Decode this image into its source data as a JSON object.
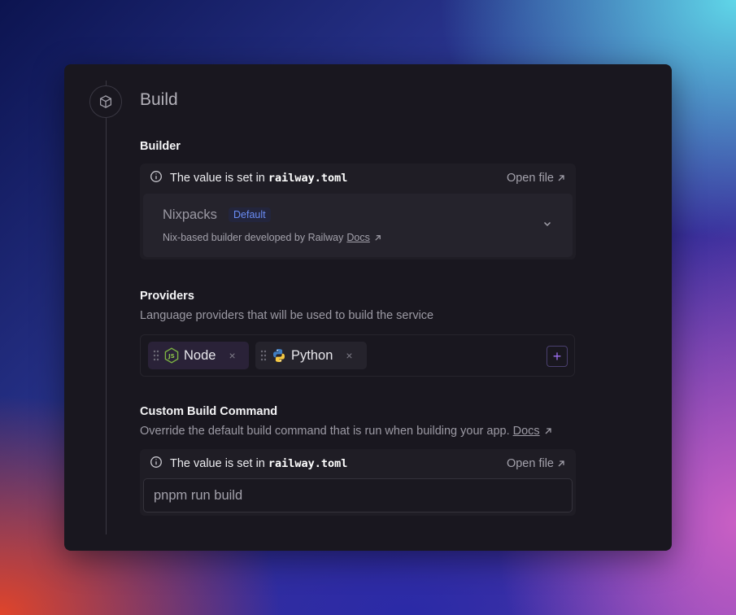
{
  "section": {
    "title": "Build",
    "icon": "cube-icon"
  },
  "builder": {
    "label": "Builder",
    "notice_prefix": "The value is set in",
    "notice_file": "railway.toml",
    "open_file": "Open file",
    "name": "Nixpacks",
    "badge": "Default",
    "description": "Nix-based builder developed by Railway",
    "docs_link": "Docs"
  },
  "providers": {
    "label": "Providers",
    "description": "Language providers that will be used to build the service",
    "items": [
      {
        "name": "Node",
        "icon": "nodejs-icon",
        "remove": "×"
      },
      {
        "name": "Python",
        "icon": "python-icon",
        "remove": "×"
      }
    ],
    "add_label": "+"
  },
  "custom_build": {
    "label": "Custom Build Command",
    "description": "Override the default build command that is run when building your app.",
    "docs_link": "Docs",
    "notice_prefix": "The value is set in",
    "notice_file": "railway.toml",
    "open_file": "Open file",
    "command_value": "pnpm run build"
  },
  "colors": {
    "card_bg": "#19171f",
    "accent_purple": "#9d6ff0",
    "badge_blue": "#6a8cf5"
  }
}
